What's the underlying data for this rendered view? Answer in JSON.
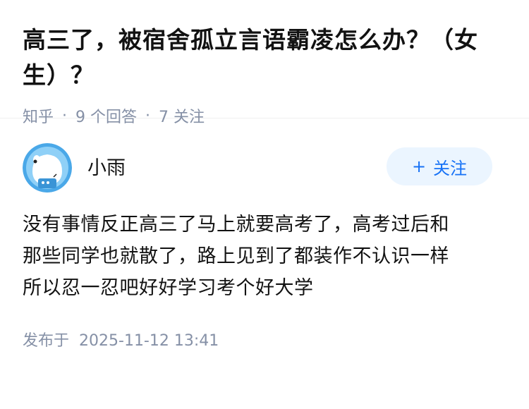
{
  "question": {
    "title": "高三了，被宿舍孤立言语霸凌怎么办？（女生）？",
    "source": "知乎",
    "answer_count": "9 个回答",
    "follower_count": "7 关注",
    "separator": "·"
  },
  "answer": {
    "author_name": "小雨",
    "follow_plus": "+",
    "follow_label": "关注",
    "content_lines": [
      "没有事情反正高三了马上就要高考了，高考过后和",
      "那些同学也就散了，路上见到了都装作不认识一样",
      "所以忍一忍吧好好学习考个好大学"
    ],
    "publish_prefix": "发布于",
    "publish_time": "2025-11-12 13:41"
  },
  "colors": {
    "accent": "#1772f6",
    "accent_bg": "#ebf5ff",
    "meta_text": "#8590a6",
    "body_text": "#121212",
    "avatar_bg": "#4aa8e8"
  },
  "icons": {
    "avatar": "cartoon-dog-astronaut-avatar"
  }
}
